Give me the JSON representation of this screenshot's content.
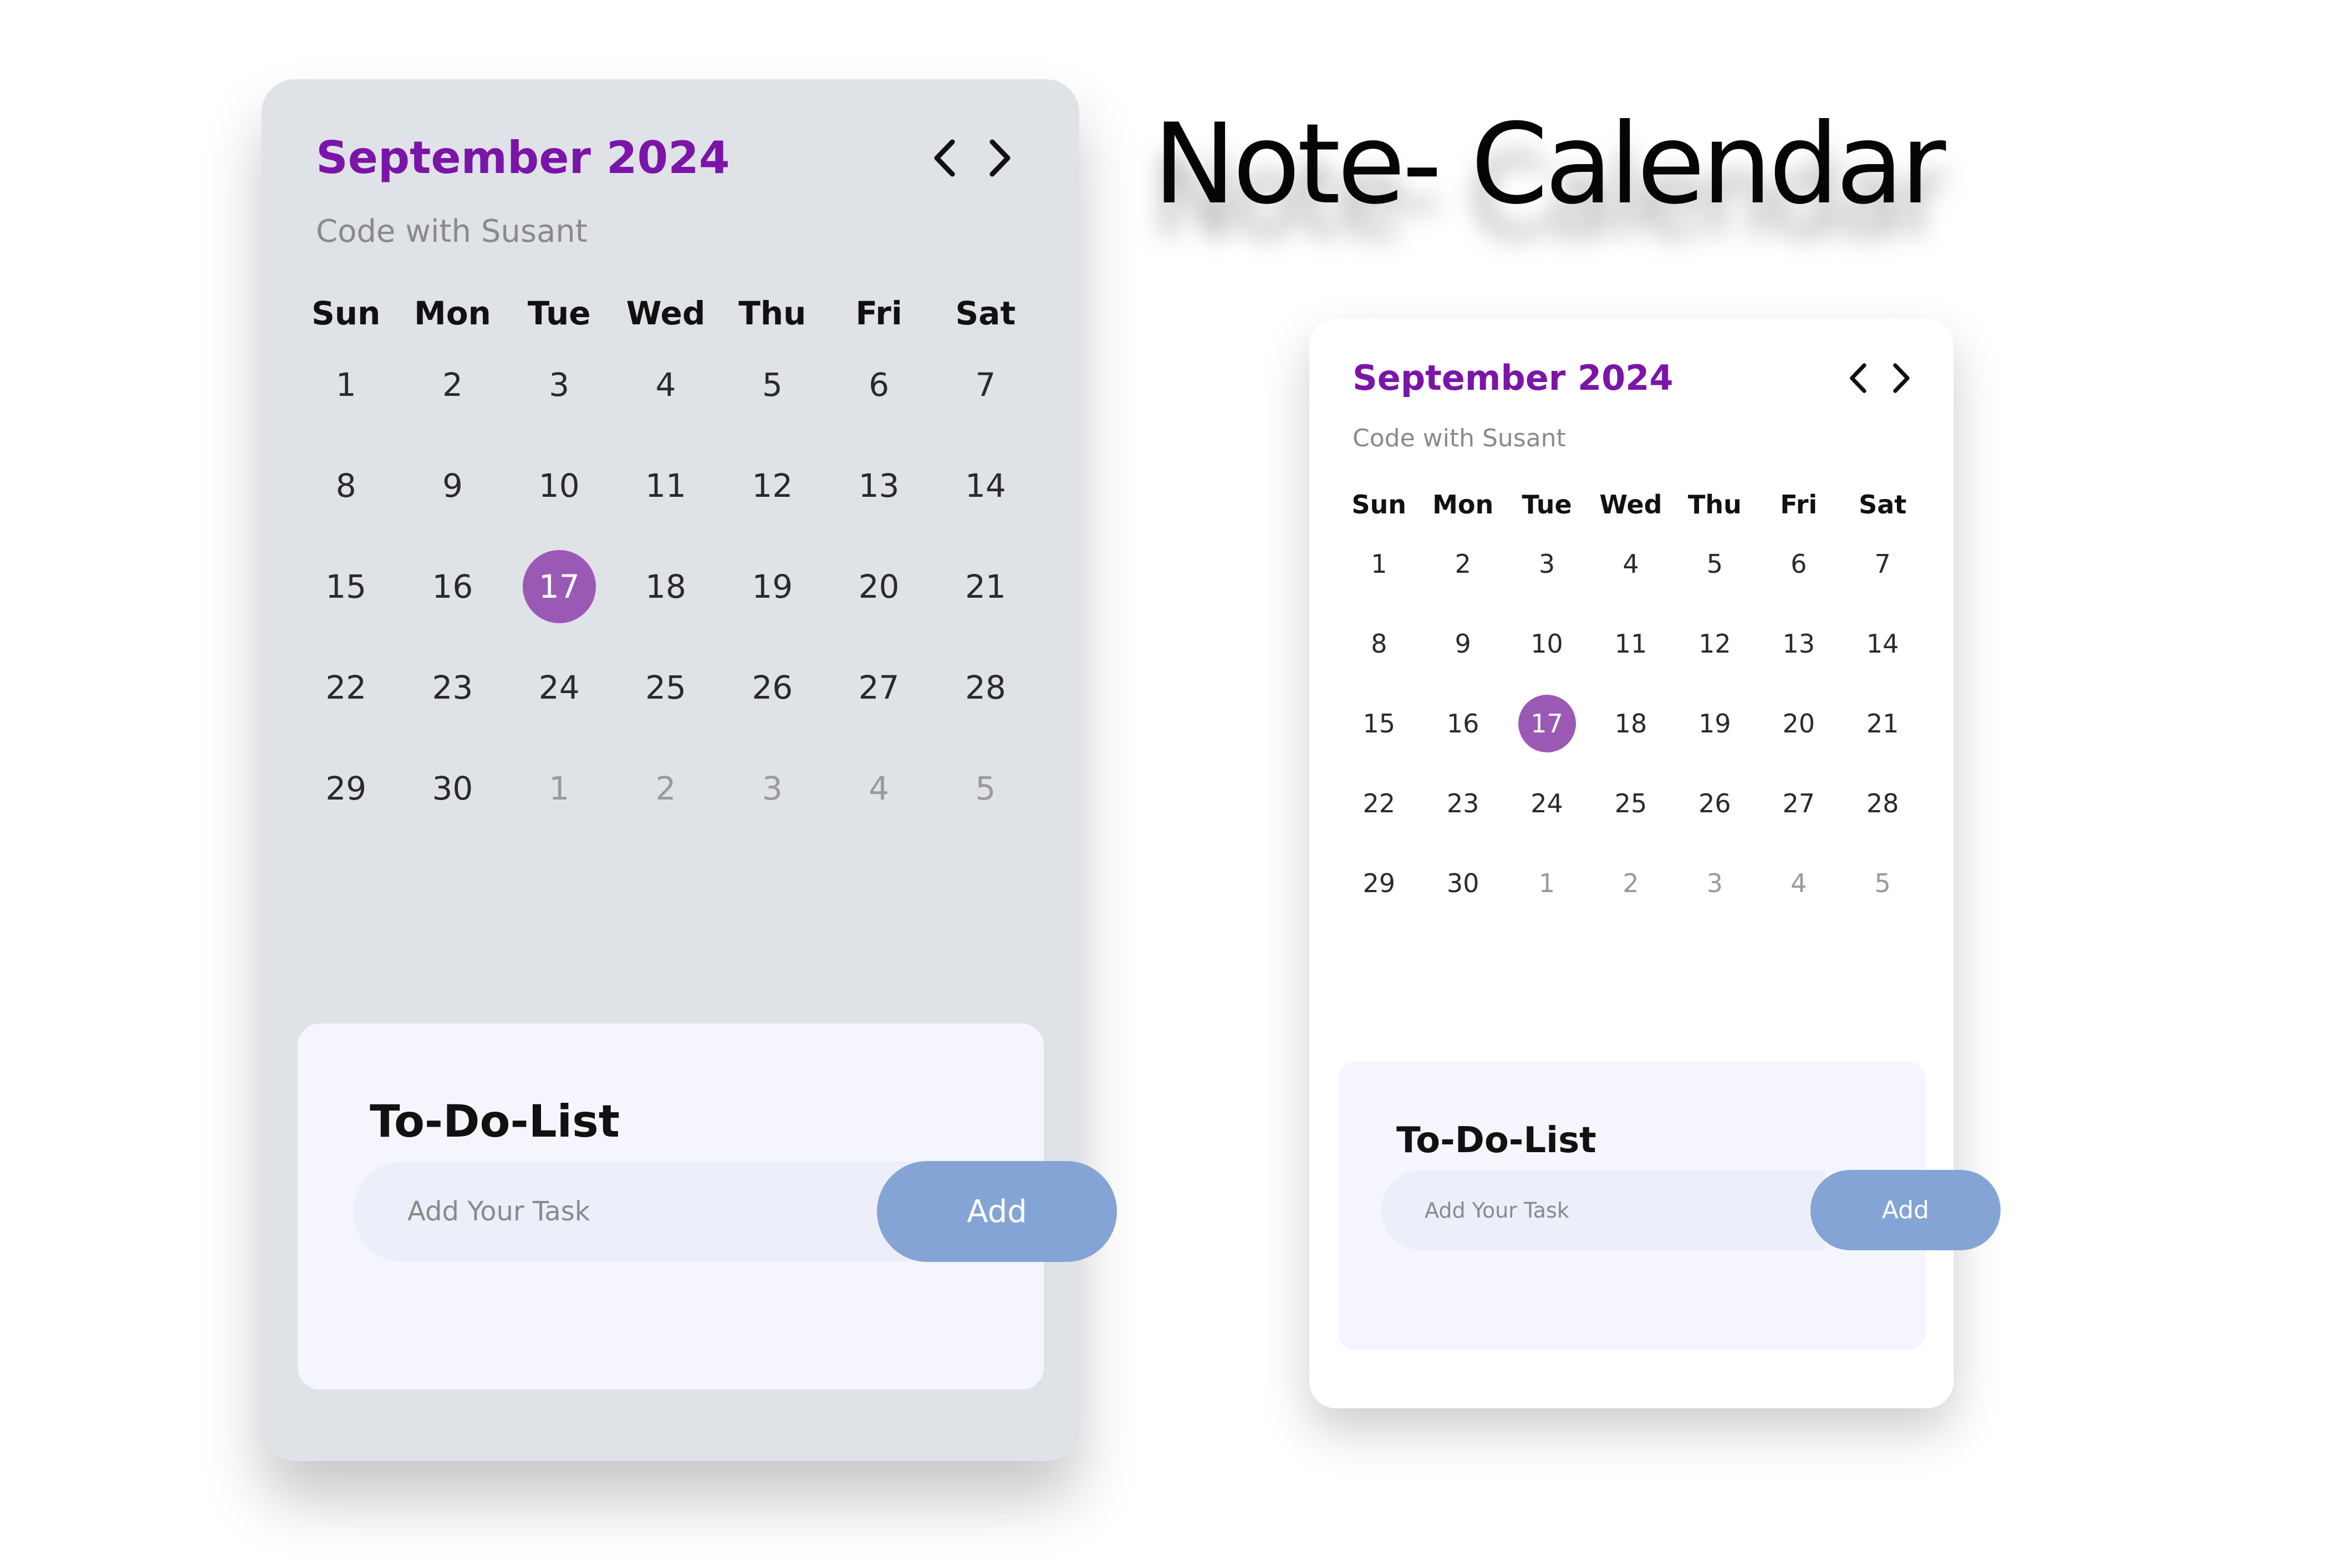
{
  "heading": "Note- Calendar",
  "calendar": {
    "month_year": "September 2024",
    "subtitle": "Code with Susant",
    "weekdays": [
      "Sun",
      "Mon",
      "Tue",
      "Wed",
      "Thu",
      "Fri",
      "Sat"
    ],
    "days": [
      {
        "label": "1"
      },
      {
        "label": "2"
      },
      {
        "label": "3"
      },
      {
        "label": "4"
      },
      {
        "label": "5"
      },
      {
        "label": "6"
      },
      {
        "label": "7"
      },
      {
        "label": "8"
      },
      {
        "label": "9"
      },
      {
        "label": "10"
      },
      {
        "label": "11"
      },
      {
        "label": "12"
      },
      {
        "label": "13"
      },
      {
        "label": "14"
      },
      {
        "label": "15"
      },
      {
        "label": "16"
      },
      {
        "label": "17",
        "today": true
      },
      {
        "label": "18"
      },
      {
        "label": "19"
      },
      {
        "label": "20"
      },
      {
        "label": "21"
      },
      {
        "label": "22"
      },
      {
        "label": "23"
      },
      {
        "label": "24"
      },
      {
        "label": "25"
      },
      {
        "label": "26"
      },
      {
        "label": "27"
      },
      {
        "label": "28"
      },
      {
        "label": "29"
      },
      {
        "label": "30"
      },
      {
        "label": "1",
        "muted": true
      },
      {
        "label": "2",
        "muted": true
      },
      {
        "label": "3",
        "muted": true
      },
      {
        "label": "4",
        "muted": true
      },
      {
        "label": "5",
        "muted": true
      }
    ]
  },
  "todo": {
    "title": "To-Do-List",
    "input_placeholder": "Add Your Task",
    "add_label": "Add"
  },
  "icons": {
    "prev": "chevron-left-icon",
    "next": "chevron-right-icon"
  },
  "colors": {
    "accent": "#7b14a8",
    "today": "#9b59b6",
    "add_button": "#84a4d6",
    "card_large_bg": "#dfe2e7",
    "card_small_bg": "#ffffff",
    "todo_bg": "#f5f6fd"
  }
}
